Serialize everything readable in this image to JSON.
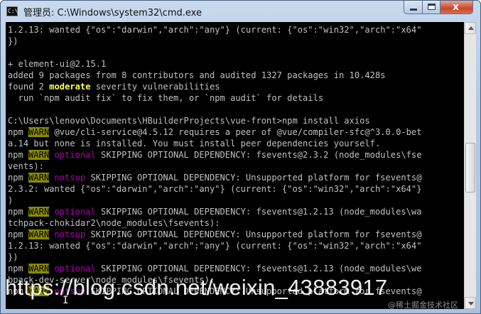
{
  "window": {
    "title": "管理员: C:\\Windows\\system32\\cmd.exe",
    "icon": "cmd-icon",
    "buttons": {
      "close_glyph": "x"
    }
  },
  "console": {
    "lines": [
      {
        "segments": [
          {
            "text": "1.2.13: wanted {\"os\":\"darwin\",\"arch\":\"any\"} (current: {\"os\":\"win32\",\"arch\":\"x64\""
          }
        ]
      },
      {
        "segments": [
          {
            "text": "})"
          }
        ]
      },
      {
        "segments": [
          {
            "text": ""
          }
        ]
      },
      {
        "segments": [
          {
            "text": "+ element-ui@2.15.1"
          }
        ]
      },
      {
        "segments": [
          {
            "text": "added 9 packages from 8 contributors and audited 1327 packages in 10.428s"
          }
        ]
      },
      {
        "segments": [
          {
            "text": "found 2 "
          },
          {
            "text": "moderate",
            "style": "moderate"
          },
          {
            "text": " severity vulnerabilities"
          }
        ]
      },
      {
        "segments": [
          {
            "text": "  run `npm audit fix` to fix them, or `npm audit` for details"
          }
        ]
      },
      {
        "segments": [
          {
            "text": ""
          }
        ]
      },
      {
        "segments": [
          {
            "text": "C:\\Users\\lenovo\\Documents\\HBuilderProjects\\vue-front>npm install axios"
          }
        ]
      },
      {
        "segments": [
          {
            "text": "npm "
          },
          {
            "text": "WARN",
            "style": "warn"
          },
          {
            "text": " @vue/cli-service@4.5.12 requires a peer of @vue/compiler-sfc@^3.0.0-bet"
          }
        ]
      },
      {
        "segments": [
          {
            "text": "a.14 but none is installed. You must install peer dependencies yourself."
          }
        ]
      },
      {
        "segments": [
          {
            "text": "npm "
          },
          {
            "text": "WARN",
            "style": "warn"
          },
          {
            "text": " "
          },
          {
            "text": "optional",
            "style": "optional"
          },
          {
            "text": " SKIPPING OPTIONAL DEPENDENCY: fsevents@2.3.2 (node_modules\\fse"
          }
        ]
      },
      {
        "segments": [
          {
            "text": "vents):"
          }
        ]
      },
      {
        "segments": [
          {
            "text": "npm "
          },
          {
            "text": "WARN",
            "style": "warn"
          },
          {
            "text": " "
          },
          {
            "text": "notsup",
            "style": "notsup"
          },
          {
            "text": " SKIPPING OPTIONAL DEPENDENCY: Unsupported platform for fsevents@"
          }
        ]
      },
      {
        "segments": [
          {
            "text": "2.3.2: wanted {\"os\":\"darwin\",\"arch\":\"any\"} (current: {\"os\":\"win32\",\"arch\":\"x64\"}"
          }
        ]
      },
      {
        "segments": [
          {
            "text": ")"
          }
        ]
      },
      {
        "segments": [
          {
            "text": "npm "
          },
          {
            "text": "WARN",
            "style": "warn"
          },
          {
            "text": " "
          },
          {
            "text": "optional",
            "style": "optional"
          },
          {
            "text": " SKIPPING OPTIONAL DEPENDENCY: fsevents@1.2.13 (node_modules\\wa"
          }
        ]
      },
      {
        "segments": [
          {
            "text": "tchpack-chokidar2\\node_modules\\fsevents):"
          }
        ]
      },
      {
        "segments": [
          {
            "text": "npm "
          },
          {
            "text": "WARN",
            "style": "warn"
          },
          {
            "text": " "
          },
          {
            "text": "notsup",
            "style": "notsup"
          },
          {
            "text": " SKIPPING OPTIONAL DEPENDENCY: Unsupported platform for fsevents@"
          }
        ]
      },
      {
        "segments": [
          {
            "text": "1.2.13: wanted {\"os\":\"darwin\",\"arch\":\"any\"} (current: {\"os\":\"win32\",\"arch\":\"x64\""
          }
        ]
      },
      {
        "segments": [
          {
            "text": "})"
          }
        ]
      },
      {
        "segments": [
          {
            "text": "npm "
          },
          {
            "text": "WARN",
            "style": "warn"
          },
          {
            "text": " "
          },
          {
            "text": "optional",
            "style": "optional"
          },
          {
            "text": " SKIPPING OPTIONAL DEPENDENCY: fsevents@1.2.13 (node_modules\\we"
          }
        ]
      },
      {
        "segments": [
          {
            "text": "bpack-dev-server\\node_modules\\fsevents):"
          }
        ]
      },
      {
        "segments": [
          {
            "text": "npm "
          },
          {
            "text": "WARN",
            "style": "warn"
          },
          {
            "text": " "
          },
          {
            "text": "notsup",
            "style": "notsup"
          },
          {
            "text": " SKIPPING OPTIONAL DEPENDENCY: Unsupported platform for fsevents@"
          }
        ]
      }
    ]
  },
  "overlay": {
    "watermark": "https://blog.csdn.net/weixin_43883917",
    "corner_mark": "@稀土掘金技术社区",
    "cursor": "I"
  },
  "colors": {
    "console_bg": "#000000",
    "console_text": "#c0c0c0",
    "warn_bg": "#8b8b00",
    "keyword_magenta": "#b000b0",
    "moderate_yellow": "#ffff55",
    "close_button": "#c9462c"
  }
}
